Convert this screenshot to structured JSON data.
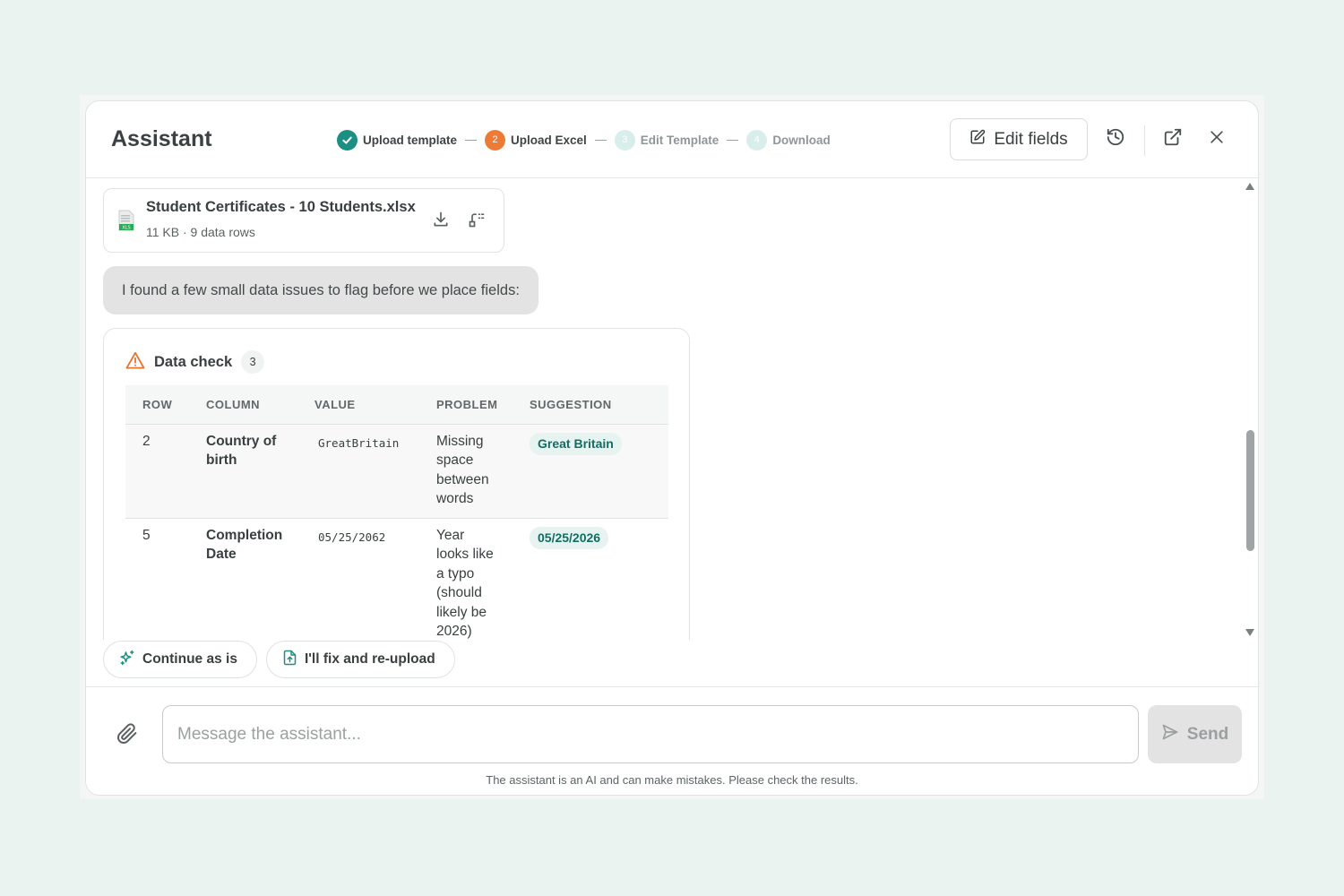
{
  "header": {
    "title": "Assistant",
    "steps": [
      {
        "number": "✓",
        "label": "Upload template",
        "state": "done"
      },
      {
        "number": "2",
        "label": "Upload Excel",
        "state": "active"
      },
      {
        "number": "3",
        "label": "Edit Template",
        "state": "todo"
      },
      {
        "number": "4",
        "label": "Download",
        "state": "todo"
      }
    ],
    "edit_fields_label": "Edit fields"
  },
  "file": {
    "name": "Student Certificates - 10 Students.xlsx",
    "meta": "11 KB · 9 data rows",
    "icon_label": "XLS"
  },
  "message": {
    "text": "I found a few small data issues to flag before we place fields:"
  },
  "data_check": {
    "title": "Data check",
    "count": "3",
    "columns": [
      "ROW",
      "COLUMN",
      "VALUE",
      "PROBLEM",
      "SUGGESTION"
    ],
    "rows": [
      {
        "row": "2",
        "column": "Country of birth",
        "value": "GreatBritain",
        "problem": "Missing space between words",
        "suggestion": "Great Britain"
      },
      {
        "row": "5",
        "column": "Completion Date",
        "value": "05/25/2062",
        "problem": "Year looks like a typo (should likely be 2026)",
        "suggestion": "05/25/2026"
      }
    ]
  },
  "actions": {
    "continue_label": "Continue as is",
    "fix_label": "I'll fix and re-upload"
  },
  "composer": {
    "placeholder": "Message the assistant...",
    "send_label": "Send",
    "disclaimer": "The assistant is an AI and can make mistakes. Please check the results."
  },
  "colors": {
    "accent_teal": "#1c8e82",
    "active_orange": "#ee7b35",
    "warning_orange": "#e8742c"
  }
}
